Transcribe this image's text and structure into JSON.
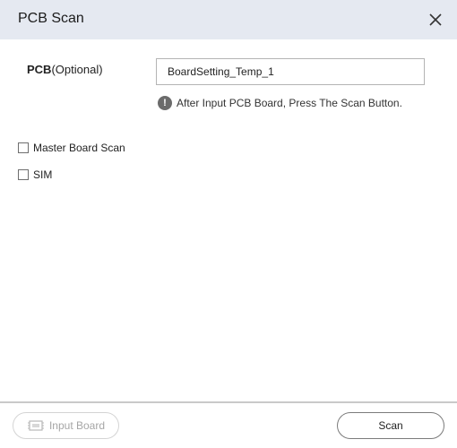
{
  "dialog": {
    "title": "PCB Scan",
    "close_icon": "close-icon"
  },
  "pcb": {
    "label_bold": "PCB",
    "label_optional": "(Optional)",
    "value": "BoardSetting_Temp_1",
    "hint_icon": "exclamation-icon",
    "hint": "After Input PCB Board, Press The Scan Button."
  },
  "options": [
    {
      "label": "Master Board Scan",
      "checked": false
    },
    {
      "label": "SIM",
      "checked": false
    }
  ],
  "footer": {
    "input_board_label": "Input Board",
    "input_board_enabled": false,
    "input_board_icon": "board-icon",
    "scan_label": "Scan"
  }
}
